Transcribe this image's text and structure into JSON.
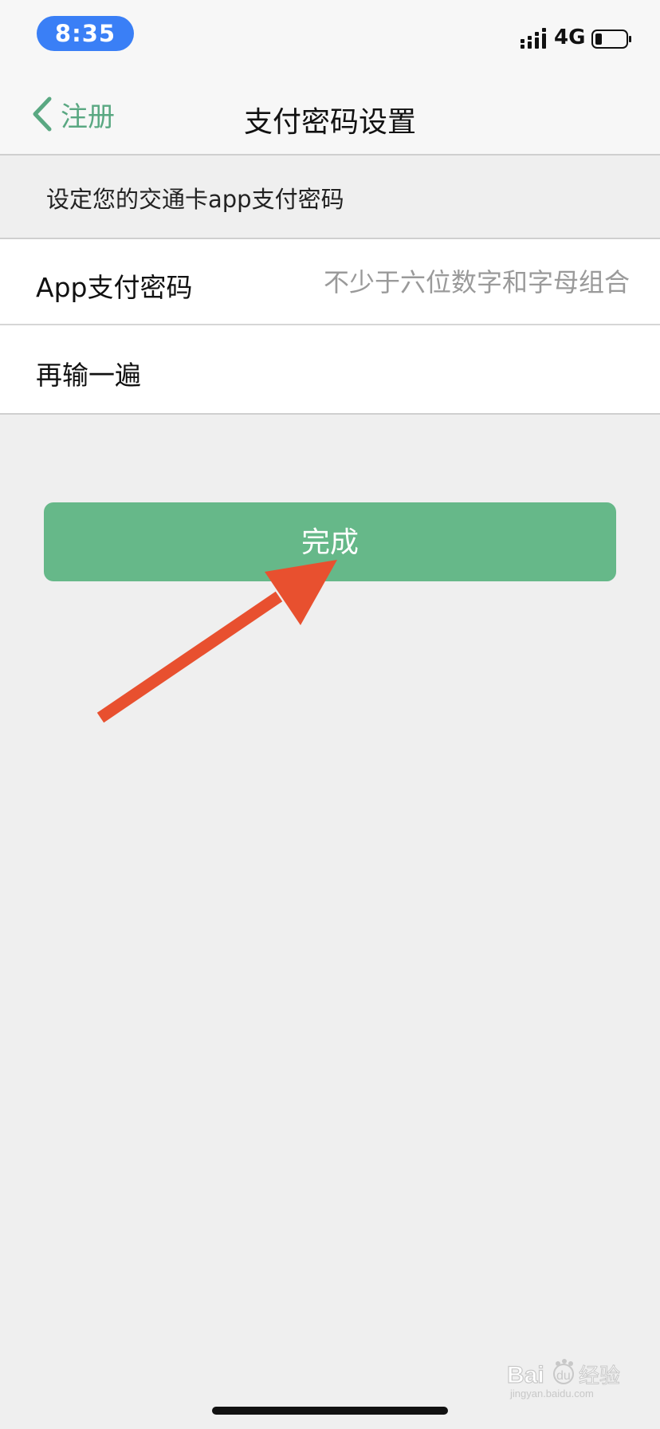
{
  "status_bar": {
    "time": "8:35",
    "network": "4G",
    "signal_icon": "signal-bars-icon",
    "battery_icon": "battery-low-icon",
    "time_pill_color": "#3a7ff6"
  },
  "nav": {
    "back_label": "注册",
    "back_icon": "chevron-left-icon",
    "title": "支付密码设置",
    "accent_color": "#5aa882"
  },
  "hint": {
    "text": "设定您的交通卡app支付密码"
  },
  "form": {
    "fields": [
      {
        "label": "App支付密码",
        "value": "",
        "placeholder": "不少于六位数字和字母组合"
      },
      {
        "label": "再输一遍",
        "value": "",
        "placeholder": ""
      }
    ]
  },
  "done_button": {
    "label": "完成",
    "color": "#66b889"
  },
  "annotation": {
    "type": "arrow",
    "color": "#e8502f",
    "target": "done_button"
  },
  "watermark": {
    "brand": "Baidu",
    "text_cn": "经验",
    "url": "jingyan.baidu.com"
  }
}
